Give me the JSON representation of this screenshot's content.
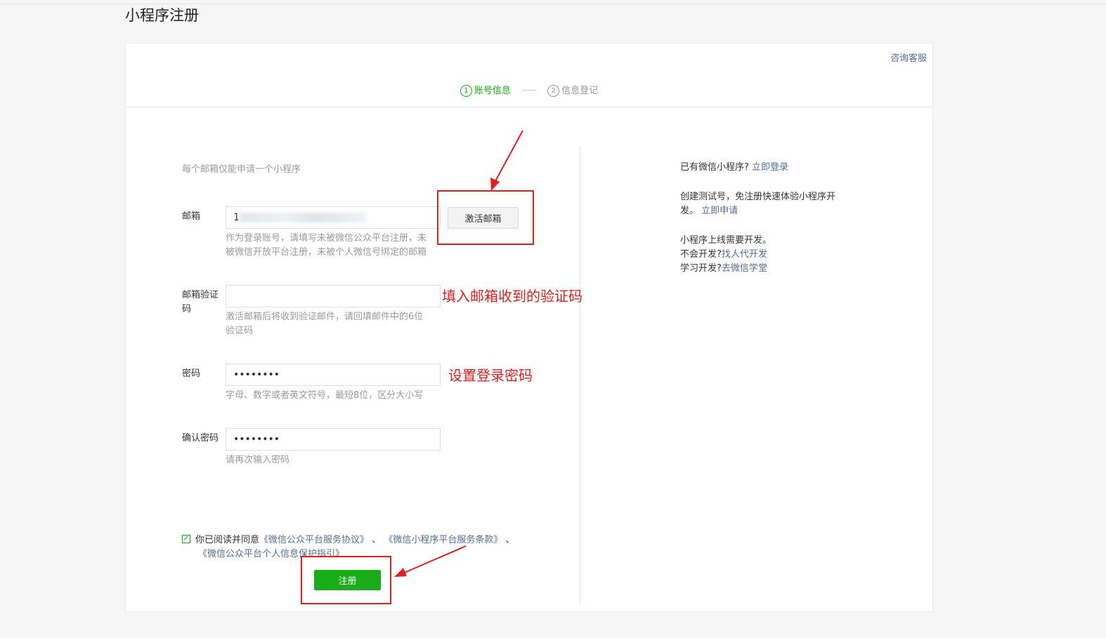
{
  "page": {
    "title": "小程序注册"
  },
  "header": {
    "consult_link": "咨询客服",
    "steps": [
      {
        "num": "1",
        "label": "账号信息"
      },
      {
        "num": "2",
        "label": "信息登记"
      }
    ]
  },
  "form": {
    "tip": "每个邮箱仅能申请一个小程序",
    "email": {
      "label": "邮箱",
      "value_prefix": "1",
      "hint": "作为登录账号，请填写未被微信公众平台注册，未被微信开放平台注册，未被个人微信号绑定的邮箱",
      "activate_button": "激活邮箱"
    },
    "verify_code": {
      "label": "邮箱验证码",
      "value": "",
      "hint": "激活邮箱后将收到验证邮件，请回填邮件中的6位验证码"
    },
    "password": {
      "label": "密码",
      "value": "••••••••",
      "hint": "字母、数字或者英文符号，最短8位，区分大小写"
    },
    "confirm_password": {
      "label": "确认密码",
      "value": "••••••••",
      "hint": "请再次输入密码"
    },
    "agreement": {
      "checked": true,
      "prefix": "你已阅读并同意",
      "link1": "《微信公众平台服务协议》",
      "sep1": "、",
      "link2": "《微信小程序平台服务条款》",
      "sep2": "、",
      "link3": "《微信公众平台个人信息保护指引》"
    },
    "register_button": "注册"
  },
  "sidebar": {
    "login_text": "已有微信小程序?",
    "login_link": "立即登录",
    "test_text": "创建测试号，免注册快速体验小程序开发。",
    "test_link": "立即申请",
    "dev_text": "小程序上线需要开发。",
    "outsource_text": "不会开发?",
    "outsource_link": "找人代开发",
    "learn_text": "学习开发?",
    "learn_link": "去微信学堂"
  },
  "annotations": {
    "verify_code_note": "填入邮箱收到的验证码",
    "password_note": "设置登录密码"
  },
  "colors": {
    "accent": "#1aad19",
    "link": "#576b95",
    "annotation": "#e02020"
  }
}
